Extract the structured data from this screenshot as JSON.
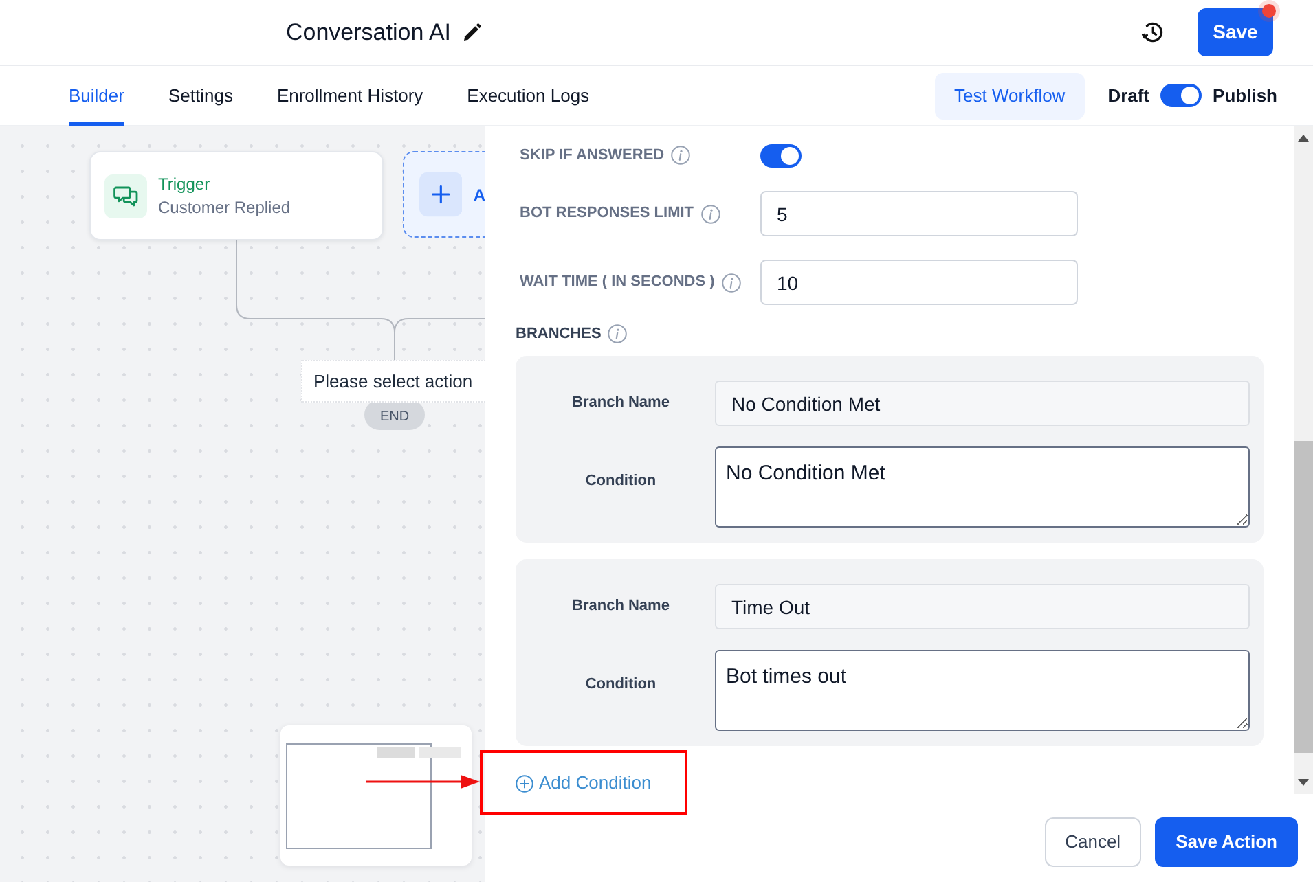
{
  "header": {
    "title": "Conversation AI",
    "save_label": "Save",
    "unsaved_changes": true
  },
  "tabs": [
    {
      "label": "Builder",
      "selected": true
    },
    {
      "label": "Settings",
      "selected": false
    },
    {
      "label": "Enrollment History",
      "selected": false
    },
    {
      "label": "Execution Logs",
      "selected": false
    }
  ],
  "toolbar": {
    "test_label": "Test Workflow",
    "draft_label": "Draft",
    "publish_label": "Publish",
    "published": true
  },
  "canvas": {
    "trigger": {
      "title": "Trigger",
      "subtitle": "Customer Replied"
    },
    "add_node": {
      "label": "A"
    },
    "pending_node": {
      "label": "Please select action"
    },
    "end_label": "END"
  },
  "panel": {
    "settings": [
      {
        "kind": "toggle",
        "label": "SKIP IF ANSWERED",
        "on": true
      },
      {
        "kind": "number",
        "label": "BOT RESPONSES LIMIT",
        "value": "5"
      },
      {
        "kind": "number",
        "label": "WAIT TIME ( IN SECONDS )",
        "value": "10"
      }
    ],
    "branches_title": "BRANCHES",
    "branches": [
      {
        "name_label": "Branch Name",
        "name": "No Condition Met",
        "name_locked": true,
        "condition_label": "Condition",
        "condition": "No Condition Met"
      },
      {
        "name_label": "Branch Name",
        "name": "Time Out",
        "name_locked": true,
        "condition_label": "Condition",
        "condition": "Bot times out"
      }
    ],
    "add_condition_label": "Add Condition",
    "actions": [
      {
        "label": "Cancel",
        "kind": "secondary"
      },
      {
        "label": "Save Action",
        "kind": "primary"
      }
    ]
  }
}
